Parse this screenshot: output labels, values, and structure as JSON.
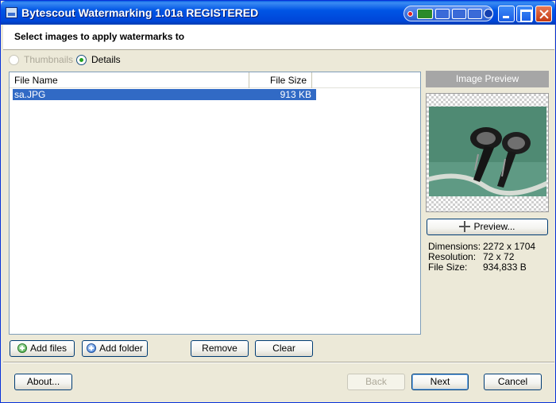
{
  "window": {
    "title": "Bytescout Watermarking 1.01a REGISTERED"
  },
  "header": {
    "text": "Select images to apply watermarks to"
  },
  "view_modes": [
    {
      "label": "Thumbnails",
      "checked": false,
      "enabled": false
    },
    {
      "label": "Details",
      "checked": true,
      "enabled": true
    }
  ],
  "file_list": {
    "columns": [
      "File Name",
      "File Size"
    ],
    "rows": [
      {
        "name": "sa.JPG",
        "size": "913 KB"
      }
    ]
  },
  "list_buttons": {
    "add_files": "Add files",
    "add_folder": "Add folder",
    "remove": "Remove",
    "clear": "Clear"
  },
  "preview": {
    "title": "Image Preview",
    "button": "Preview...",
    "info": [
      {
        "label": "Dimensions:",
        "value": "2272 x 1704"
      },
      {
        "label": "Resolution:",
        "value": "72 x 72"
      },
      {
        "label": "File Size:",
        "value": "934,833 B"
      }
    ]
  },
  "footer": {
    "about": "About...",
    "back": "Back",
    "next": "Next",
    "cancel": "Cancel"
  }
}
